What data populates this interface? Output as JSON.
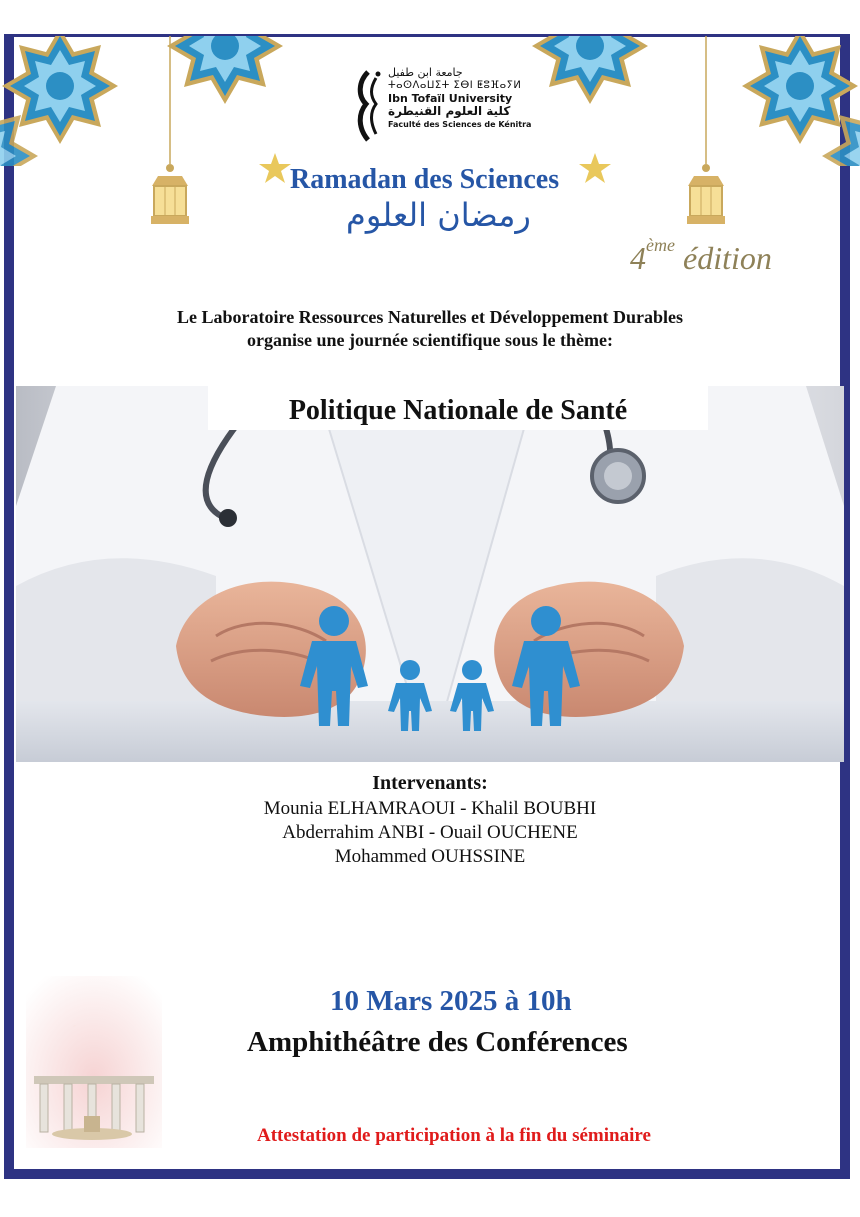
{
  "logo": {
    "arabic_university": "جامعة ابن طفيل",
    "tifinagh": "ⵜⴰⵙⴷⴰⵡⵉⵜ ⵉⴱⵏ ⵟⵓⴼⴰⵢⵍ",
    "university": "Ibn Tofaïl University",
    "arabic_faculty": "كلية العلوم القنيطرة",
    "faculty": "Faculté des Sciences de Kénitra"
  },
  "event": {
    "title_fr": "Ramadan des Sciences",
    "title_ar": "رمضان العلوم",
    "edition_number": "4",
    "edition_sup": "ème",
    "edition_word": "édition"
  },
  "intro": {
    "line1": "Le Laboratoire Ressources Naturelles et Développement Durables",
    "line2": "organise une journée scientifique sous le thème:"
  },
  "theme": "Politique Nationale de Santé",
  "speakers": {
    "heading": "Intervenants:",
    "lines": [
      "Mounia ELHAMRAOUI - Khalil BOUBHI",
      "Abderrahim ANBI - Ouail OUCHENE",
      "Mohammed OUHSSINE"
    ]
  },
  "schedule": {
    "date": "10 Mars 2025  à  10h",
    "place": "Amphithéâtre des Conférences"
  },
  "notice": "Attestation de participation à la fin du séminaire",
  "colors": {
    "frame": "#2e3383",
    "title_blue": "#2656a6",
    "edition_gold": "#8e8158",
    "notice_red": "#e01b1b",
    "figure_blue": "#2f8fd0"
  }
}
